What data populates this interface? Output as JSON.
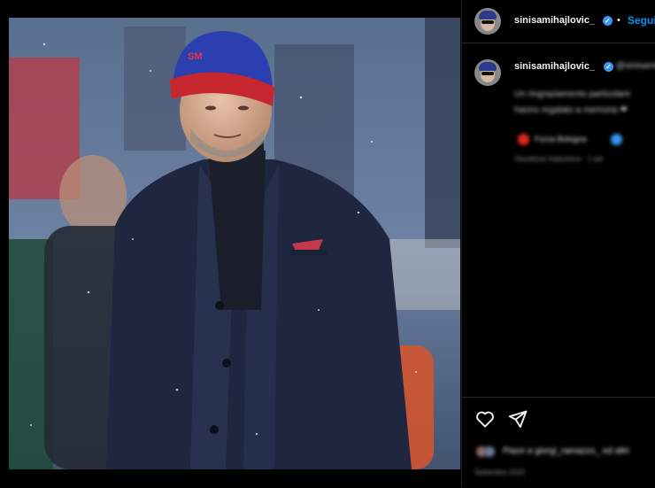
{
  "post": {
    "image_alt": "Coach in navy coat and blue-red SM beanie on a stadium sideline",
    "hat_text": "SM"
  },
  "header": {
    "username": "sinisamihajlovic_",
    "verified_mark": "✓",
    "separator": "•",
    "follow_label": "Segui"
  },
  "caption": {
    "username": "sinisamihajlovic_",
    "verified_mark": "✓",
    "mention": "@sinisamihajlovic",
    "lines": [
      "Un ringraziamento particolare",
      "hanno regalato a memoria ❤"
    ],
    "tag_text": "Forza Bologna",
    "meta_text": "Visualizza traduzione · 1 set"
  },
  "actions": {
    "like_icon": "heart-icon",
    "share_icon": "send-icon",
    "likes_text": "Piace a giorgi_ramazzo_ ed altri",
    "date_text": "Settembre 2022"
  },
  "colors": {
    "accent": "#0095f6",
    "verified": "#3897f0",
    "background": "#000000"
  }
}
